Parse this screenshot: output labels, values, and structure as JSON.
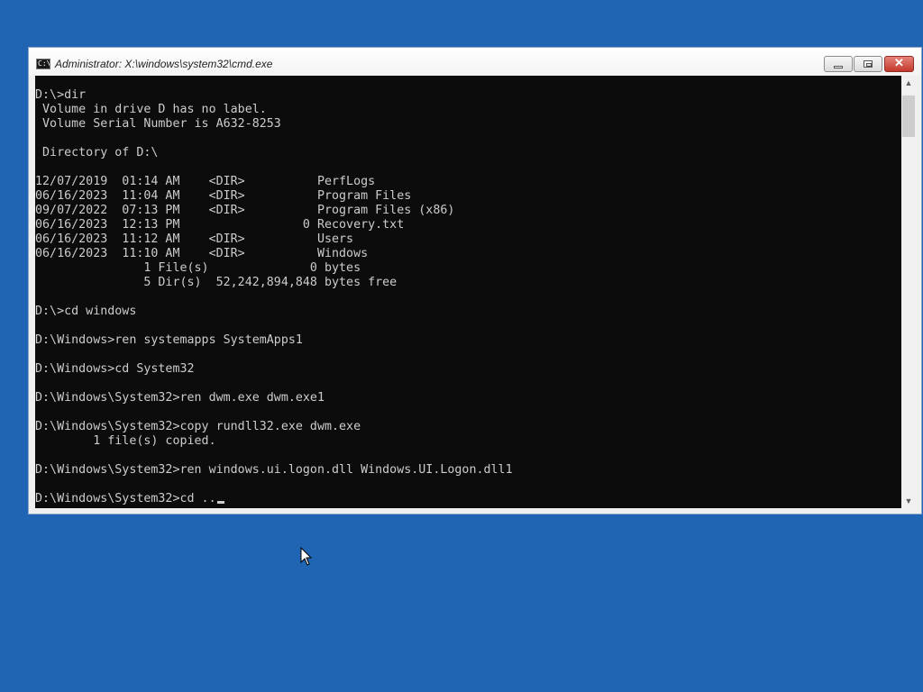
{
  "window": {
    "title": "Administrator: X:\\windows\\system32\\cmd.exe",
    "app_icon_glyph": "C:\\",
    "icons": {
      "app": "command-prompt-icon",
      "minimize": "minimize-icon",
      "maximize": "maximize-icon",
      "close": "close-icon",
      "scroll_up": "scroll-up-arrow-icon",
      "scroll_down": "scroll-down-arrow-icon",
      "pointer": "mouse-pointer-icon"
    },
    "close_glyph": "✕",
    "scroll_up_glyph": "▲",
    "scroll_down_glyph": "▼"
  },
  "console": {
    "lines": [
      "D:\\>dir",
      " Volume in drive D has no label.",
      " Volume Serial Number is A632-8253",
      "",
      " Directory of D:\\",
      "",
      "12/07/2019  01:14 AM    <DIR>          PerfLogs",
      "06/16/2023  11:04 AM    <DIR>          Program Files",
      "09/07/2022  07:13 PM    <DIR>          Program Files (x86)",
      "06/16/2023  12:13 PM                 0 Recovery.txt",
      "06/16/2023  11:12 AM    <DIR>          Users",
      "06/16/2023  11:10 AM    <DIR>          Windows",
      "               1 File(s)              0 bytes",
      "               5 Dir(s)  52,242,894,848 bytes free",
      "",
      "D:\\>cd windows",
      "",
      "D:\\Windows>ren systemapps SystemApps1",
      "",
      "D:\\Windows>cd System32",
      "",
      "D:\\Windows\\System32>ren dwm.exe dwm.exe1",
      "",
      "D:\\Windows\\System32>copy rundll32.exe dwm.exe",
      "        1 file(s) copied.",
      "",
      "D:\\Windows\\System32>ren windows.ui.logon.dll Windows.UI.Logon.dll1",
      ""
    ],
    "prompt_line": "D:\\Windows\\System32>cd .."
  },
  "colors": {
    "desktop": "#1f65b4",
    "console_bg": "#0c0c0c",
    "console_text": "#cccccc",
    "close_button": "#c4392c"
  }
}
